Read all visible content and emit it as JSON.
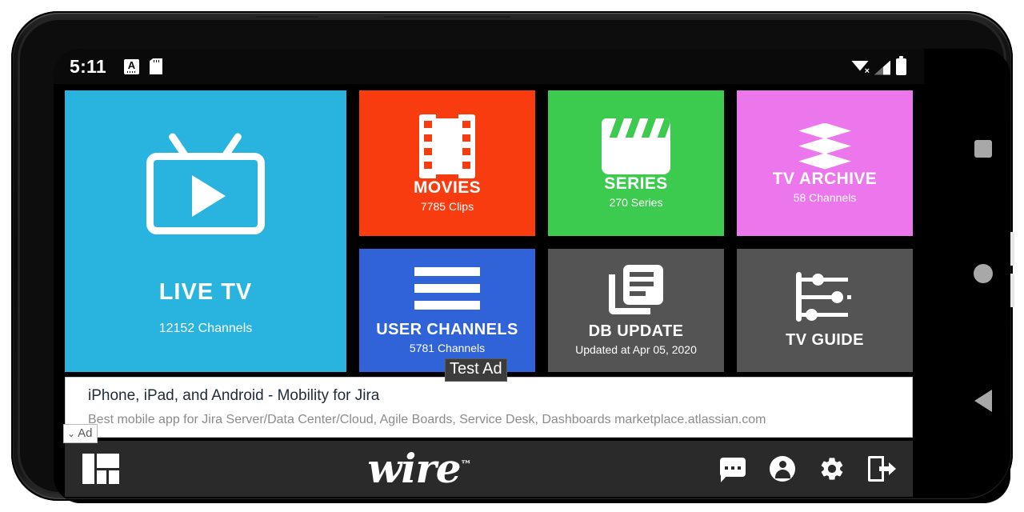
{
  "status_bar": {
    "time": "5:11",
    "left_icons": [
      "keyboard-icon",
      "sd-card-icon"
    ],
    "keyboard_letter": "A",
    "right_icons": [
      "wifi-off-icon",
      "cellular-signal-icon",
      "battery-icon"
    ],
    "wifi_badge": "×"
  },
  "tiles": {
    "live_tv": {
      "title": "LIVE TV",
      "subtitle": "12152 Channels",
      "color": "#29b4e0",
      "icon": "tv-play-icon"
    },
    "movies": {
      "title": "MOVIES",
      "subtitle": "7785 Clips",
      "color": "#f93c10",
      "icon": "film-strip-icon"
    },
    "series": {
      "title": "SERIES",
      "subtitle": "270 Series",
      "color": "#3ccb4f",
      "icon": "clapperboard-icon"
    },
    "tv_archive": {
      "title": "TV ARCHIVE",
      "subtitle": "58 Channels",
      "color": "#ec77ec",
      "icon": "layers-icon"
    },
    "user_channels": {
      "title": "USER CHANNELS",
      "subtitle": "5781 Channels",
      "color": "#3163d8",
      "icon": "hamburger-menu-icon"
    },
    "db_update": {
      "title": "DB UPDATE",
      "subtitle": "Updated at Apr 05, 2020",
      "color": "#545454",
      "icon": "document-news-icon"
    },
    "tv_guide": {
      "title": "TV GUIDE",
      "subtitle": "",
      "color": "#545454",
      "icon": "tv-schedule-icon"
    }
  },
  "ad": {
    "headline": "iPhone, iPad, and Android - Mobility for Jira",
    "description": "Best mobile app for Jira Server/Data Center/Cloud, Agile Boards, Service Desk, Dashboards ",
    "url": "marketplace.atlassian.com",
    "badge_label": "Ad",
    "badge_chevron": "⌄",
    "tooltip": "Test Ad"
  },
  "bottom_bar": {
    "grid_label": "dashboard-grid-icon",
    "logo_text": "wire",
    "logo_tm": "™",
    "actions": [
      "chat-icon",
      "account-icon",
      "settings-gear-icon",
      "logout-icon"
    ]
  },
  "android_nav": {
    "items": [
      "recents-square-icon",
      "home-circle-icon",
      "back-triangle-icon"
    ]
  }
}
